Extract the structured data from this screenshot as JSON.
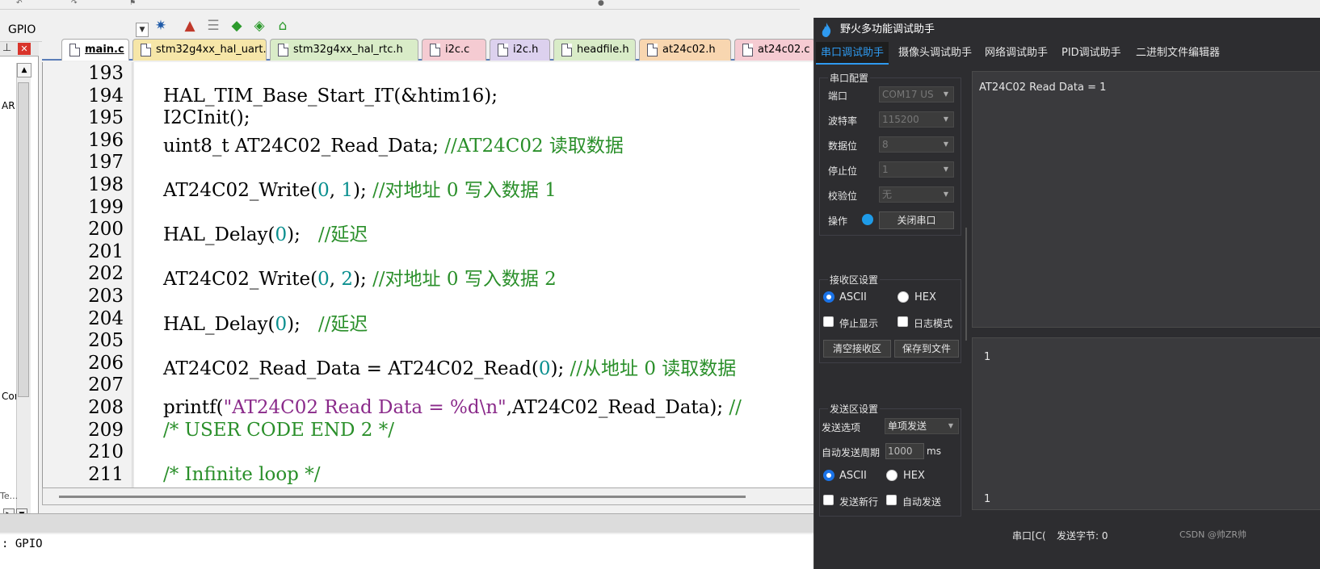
{
  "ide": {
    "combo_value": "GPIO",
    "left_pane": {
      "fragment_ar": "AR",
      "fragment_cor": "Cor",
      "fragment_te": "Te..."
    },
    "tabs": [
      {
        "label": "main.c",
        "active": true,
        "color": "#ffffff"
      },
      {
        "label": "stm32g4xx_hal_uart.c",
        "active": false,
        "color": "#f6e6a8"
      },
      {
        "label": "stm32g4xx_hal_rtc.h",
        "active": false,
        "color": "#d9ecc8"
      },
      {
        "label": "i2c.c",
        "active": false,
        "color": "#f5cbd2"
      },
      {
        "label": "i2c.h",
        "active": false,
        "color": "#dcd1ee"
      },
      {
        "label": "headfile.h",
        "active": false,
        "color": "#d9ecc8"
      },
      {
        "label": "at24c02.h",
        "active": false,
        "color": "#f8d6b0"
      },
      {
        "label": "at24c02.c",
        "active": false,
        "color": "#f5cbd2"
      }
    ],
    "line_numbers": [
      "193",
      "194",
      "195",
      "196",
      "197",
      "198",
      "199",
      "200",
      "201",
      "202",
      "203",
      "204",
      "205",
      "206",
      "207",
      "208",
      "209",
      "210",
      "211"
    ],
    "code_lines": [
      [],
      [
        {
          "t": "HAL_TIM_Base_Start_IT(&htim16);",
          "c": ""
        }
      ],
      [
        {
          "t": "I2CInit();",
          "c": ""
        }
      ],
      [
        {
          "t": "uint8_t AT24C02_Read_Data; ",
          "c": ""
        },
        {
          "t": "//AT24C02 读取数据",
          "c": "cmt"
        }
      ],
      [],
      [
        {
          "t": "AT24C02_Write(",
          "c": ""
        },
        {
          "t": "0",
          "c": "num"
        },
        {
          "t": ", ",
          "c": ""
        },
        {
          "t": "1",
          "c": "num"
        },
        {
          "t": "); ",
          "c": ""
        },
        {
          "t": "//对地址 0 写入数据 1",
          "c": "cmt"
        }
      ],
      [],
      [
        {
          "t": "HAL_Delay(",
          "c": ""
        },
        {
          "t": "0",
          "c": "num"
        },
        {
          "t": ");   ",
          "c": ""
        },
        {
          "t": "//延迟",
          "c": "cmt"
        }
      ],
      [],
      [
        {
          "t": "AT24C02_Write(",
          "c": ""
        },
        {
          "t": "0",
          "c": "num"
        },
        {
          "t": ", ",
          "c": ""
        },
        {
          "t": "2",
          "c": "num"
        },
        {
          "t": "); ",
          "c": ""
        },
        {
          "t": "//对地址 0 写入数据 2",
          "c": "cmt"
        }
      ],
      [],
      [
        {
          "t": "HAL_Delay(",
          "c": ""
        },
        {
          "t": "0",
          "c": "num"
        },
        {
          "t": ");   ",
          "c": ""
        },
        {
          "t": "//延迟",
          "c": "cmt"
        }
      ],
      [],
      [
        {
          "t": "AT24C02_Read_Data = AT24C02_Read(",
          "c": ""
        },
        {
          "t": "0",
          "c": "num"
        },
        {
          "t": "); ",
          "c": ""
        },
        {
          "t": "//从地址 0 读取数据",
          "c": "cmt"
        }
      ],
      [],
      [
        {
          "t": "printf(",
          "c": ""
        },
        {
          "t": "\"AT24C02 Read Data = %d\\n\"",
          "c": "str"
        },
        {
          "t": ",AT24C02_Read_Data); ",
          "c": ""
        },
        {
          "t": "//",
          "c": "cmt"
        }
      ],
      [
        {
          "t": "/* USER CODE END 2 */",
          "c": "cmt"
        }
      ],
      [],
      [
        {
          "t": "/* Infinite loop */",
          "c": "cmt"
        }
      ]
    ],
    "bottom_text": ": GPIO"
  },
  "assistant": {
    "title": "野火多功能调试助手",
    "tabs": [
      "串口调试助手",
      "摄像头调试助手",
      "网络调试助手",
      "PID调试助手",
      "二进制文件编辑器"
    ],
    "serial_config": {
      "title": "串口配置",
      "port_label": "端口",
      "port_value": "COM17 US",
      "baud_label": "波特率",
      "baud_value": "115200",
      "databits_label": "数据位",
      "databits_value": "8",
      "stopbits_label": "停止位",
      "stopbits_value": "1",
      "parity_label": "校验位",
      "parity_value": "无",
      "op_label": "操作",
      "close_port_label": "关闭串口"
    },
    "receive": {
      "title": "接收区设置",
      "ascii_label": "ASCII",
      "hex_label": "HEX",
      "stop_display_label": "停止显示",
      "log_mode_label": "日志模式",
      "clear_label": "清空接收区",
      "save_label": "保存到文件",
      "content": "AT24C02 Read Data = 1",
      "content2": "1"
    },
    "send": {
      "title": "发送区设置",
      "option_label": "发送选项",
      "option_value": "单项发送",
      "period_label": "自动发送周期",
      "period_value": "1000",
      "period_unit": "ms",
      "ascii_label": "ASCII",
      "hex_label": "HEX",
      "newline_label": "发送新行",
      "auto_send_label": "自动发送",
      "content": "1"
    },
    "status": {
      "port_fragment": "串口[C(",
      "sent_bytes": "发送字节: 0"
    },
    "watermark": "CSDN @帅ZR帅"
  }
}
